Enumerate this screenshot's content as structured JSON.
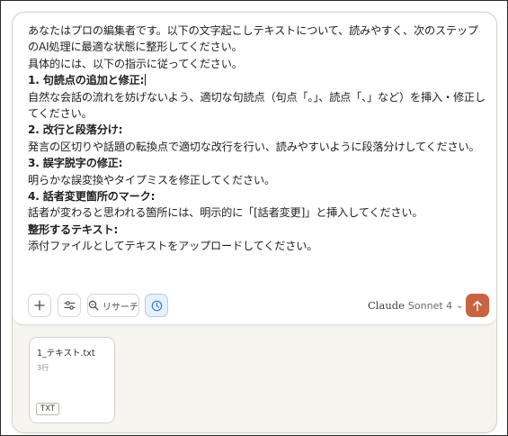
{
  "prompt": {
    "lines": [
      {
        "text": "あなたはプロの編集者です。以下の文字起こしテキストについて、読みやすく、次のステップのAI処理に最適な状態に整形してください。",
        "bold": false
      },
      {
        "text": "具体的には、以下の指示に従ってください。",
        "bold": false
      },
      {
        "text": "1. 句読点の追加と修正:",
        "bold": true,
        "caret": true
      },
      {
        "text": "自然な会話の流れを妨げないよう、適切な句読点（句点「。」、読点「、」など）を挿入・修正してください。",
        "bold": false
      },
      {
        "text": "2. 改行と段落分け:",
        "bold": true
      },
      {
        "text": "発言の区切りや話題の転換点で適切な改行を行い、読みやすいように段落分けしてください。",
        "bold": false
      },
      {
        "text": "3. 誤字脱字の修正:",
        "bold": true
      },
      {
        "text": "明らかな誤変換やタイプミスを修正してください。",
        "bold": false
      },
      {
        "text": "4. 話者変更箇所のマーク:",
        "bold": true
      },
      {
        "text": "話者が変わると思われる箇所には、明示的に「[話者変更]」と挿入してください。",
        "bold": false
      },
      {
        "text": "整形するテキスト:",
        "bold": true
      },
      {
        "text": "添付ファイルとしてテキストをアップロードしてください。",
        "bold": false
      }
    ]
  },
  "toolbar": {
    "plus_icon": "plus-icon",
    "tools_icon": "sliders-icon",
    "research_label": "リサーチ",
    "research_icon": "search-icon",
    "clock_icon": "clock-icon",
    "model_name": "Claude",
    "model_variant": "Sonnet 4",
    "model_chevron": "⌄",
    "send_icon": "arrow-up-icon",
    "send_color": "#c96442",
    "active_tool_color": "#2f7fd0"
  },
  "attachment": {
    "filename": "1_テキスト.txt",
    "meta": "3行",
    "type": "TXT"
  }
}
